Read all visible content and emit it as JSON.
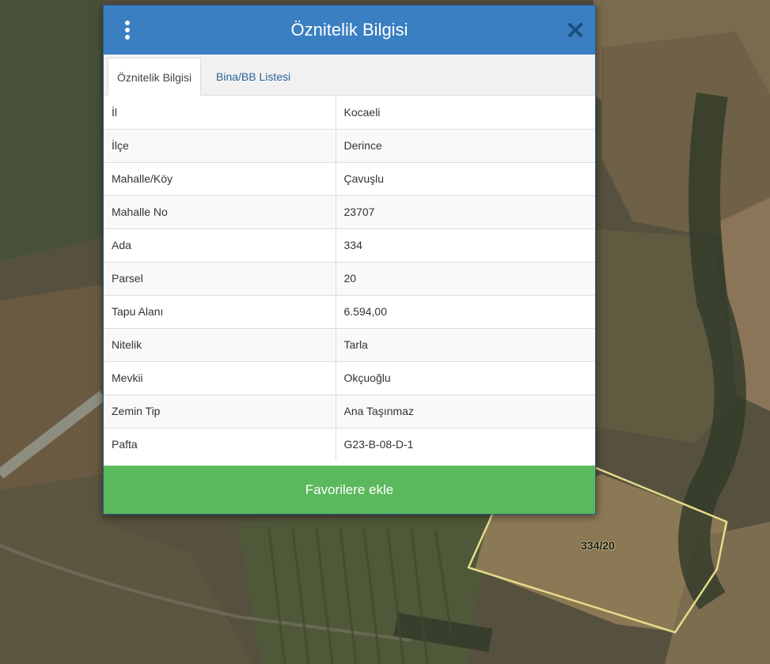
{
  "dialog": {
    "title": "Öznitelik Bilgisi",
    "menu_icon": "vertical-ellipsis-icon",
    "close_icon": "close-icon",
    "tabs": [
      {
        "label": "Öznitelik Bilgisi",
        "active": true
      },
      {
        "label": "Bina/BB Listesi",
        "active": false
      }
    ],
    "rows": [
      {
        "key": "İl",
        "value": "Kocaeli"
      },
      {
        "key": "İlçe",
        "value": "Derince"
      },
      {
        "key": "Mahalle/Köy",
        "value": "Çavuşlu"
      },
      {
        "key": "Mahalle No",
        "value": "23707"
      },
      {
        "key": "Ada",
        "value": "334"
      },
      {
        "key": "Parsel",
        "value": "20"
      },
      {
        "key": "Tapu Alanı",
        "value": "6.594,00"
      },
      {
        "key": "Nitelik",
        "value": "Tarla"
      },
      {
        "key": "Mevkii",
        "value": "Okçuoğlu"
      },
      {
        "key": "Zemin Tip",
        "value": "Ana Taşınmaz"
      },
      {
        "key": "Pafta",
        "value": "G23-B-08-D-1"
      }
    ],
    "favorite_button": "Favorilere ekle"
  },
  "map": {
    "parcel_label": "334/20"
  },
  "colors": {
    "header": "#3a7fc1",
    "favorite_button": "#5cb85c",
    "tab_link": "#2a6496",
    "parcel_outline": "#e6dc8a"
  }
}
